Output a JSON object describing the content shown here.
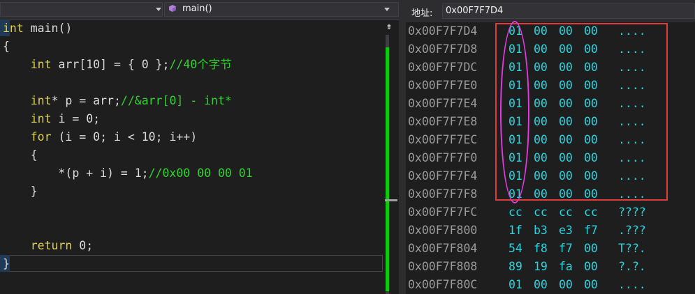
{
  "editor": {
    "function_combo": "main()",
    "code_lines": [
      [
        {
          "t": "int",
          "c": "kw"
        },
        {
          "t": " main()",
          "c": "pl"
        }
      ],
      [
        {
          "t": "{",
          "c": "pl"
        }
      ],
      [
        {
          "t": "    ",
          "c": "pl"
        },
        {
          "t": "int",
          "c": "kw"
        },
        {
          "t": " arr[10] = { 0 };",
          "c": "pl"
        },
        {
          "t": "//40个字节",
          "c": "cm"
        }
      ],
      [],
      [
        {
          "t": "    ",
          "c": "pl"
        },
        {
          "t": "int",
          "c": "kw"
        },
        {
          "t": "* p = arr;",
          "c": "pl"
        },
        {
          "t": "//&arr[0] - int*",
          "c": "cm"
        }
      ],
      [
        {
          "t": "    ",
          "c": "pl"
        },
        {
          "t": "int",
          "c": "kw"
        },
        {
          "t": " i = 0;",
          "c": "pl"
        }
      ],
      [
        {
          "t": "    ",
          "c": "pl"
        },
        {
          "t": "for",
          "c": "kw"
        },
        {
          "t": " (i = 0; i < 10; i++)",
          "c": "pl"
        }
      ],
      [
        {
          "t": "    {",
          "c": "pl"
        }
      ],
      [
        {
          "t": "        *(p + i) = 1;",
          "c": "pl"
        },
        {
          "t": "//0x00 00 00 01",
          "c": "cm"
        }
      ],
      [
        {
          "t": "    }",
          "c": "pl"
        }
      ],
      [],
      [],
      [
        {
          "t": "    ",
          "c": "pl"
        },
        {
          "t": "return",
          "c": "kw"
        },
        {
          "t": " 0;",
          "c": "pl"
        }
      ],
      [
        {
          "t": "}",
          "c": "pl"
        }
      ]
    ]
  },
  "memory": {
    "address_label": "地址:",
    "address_value": "0x00F7F7D4",
    "rows": [
      {
        "addr": "0x00F7F7D4",
        "bytes": [
          "01",
          "00",
          "00",
          "00"
        ],
        "ascii": "...."
      },
      {
        "addr": "0x00F7F7D8",
        "bytes": [
          "01",
          "00",
          "00",
          "00"
        ],
        "ascii": "...."
      },
      {
        "addr": "0x00F7F7DC",
        "bytes": [
          "01",
          "00",
          "00",
          "00"
        ],
        "ascii": "...."
      },
      {
        "addr": "0x00F7F7E0",
        "bytes": [
          "01",
          "00",
          "00",
          "00"
        ],
        "ascii": "...."
      },
      {
        "addr": "0x00F7F7E4",
        "bytes": [
          "01",
          "00",
          "00",
          "00"
        ],
        "ascii": "...."
      },
      {
        "addr": "0x00F7F7E8",
        "bytes": [
          "01",
          "00",
          "00",
          "00"
        ],
        "ascii": "...."
      },
      {
        "addr": "0x00F7F7EC",
        "bytes": [
          "01",
          "00",
          "00",
          "00"
        ],
        "ascii": "...."
      },
      {
        "addr": "0x00F7F7F0",
        "bytes": [
          "01",
          "00",
          "00",
          "00"
        ],
        "ascii": "...."
      },
      {
        "addr": "0x00F7F7F4",
        "bytes": [
          "01",
          "00",
          "00",
          "00"
        ],
        "ascii": "...."
      },
      {
        "addr": "0x00F7F7F8",
        "bytes": [
          "01",
          "00",
          "00",
          "00"
        ],
        "ascii": "...."
      },
      {
        "addr": "0x00F7F7FC",
        "bytes": [
          "cc",
          "cc",
          "cc",
          "cc"
        ],
        "ascii": "????"
      },
      {
        "addr": "0x00F7F800",
        "bytes": [
          "1f",
          "b3",
          "e3",
          "f7"
        ],
        "ascii": ".???"
      },
      {
        "addr": "0x00F7F804",
        "bytes": [
          "54",
          "f8",
          "f7",
          "00"
        ],
        "ascii": "T??."
      },
      {
        "addr": "0x00F7F808",
        "bytes": [
          "89",
          "19",
          "fa",
          "00"
        ],
        "ascii": "?.?."
      },
      {
        "addr": "0x00F7F80C",
        "bytes": [
          "01",
          "00",
          "00",
          "00"
        ],
        "ascii": "...."
      }
    ]
  },
  "annotations": {
    "box_color": "#e03a3a",
    "ellipse_color": "#e23ae0"
  },
  "icons": {
    "function_icon": "cube-icon",
    "split_icon": "split-window-icon"
  }
}
